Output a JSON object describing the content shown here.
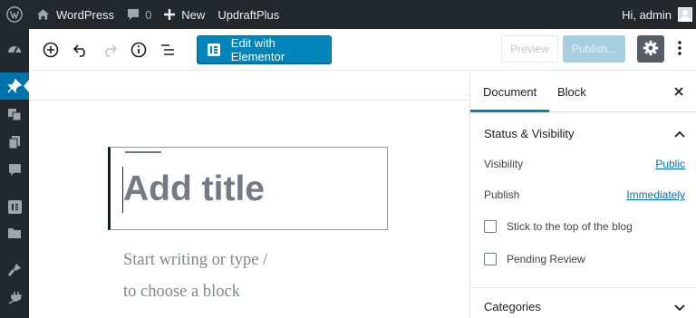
{
  "adminbar": {
    "site_name": "WordPress",
    "comments_count": "0",
    "new_label": "New",
    "plugin_label": "UpdraftPlus",
    "greeting": "Hi, admin"
  },
  "toolbar": {
    "edit_elementor_label": "Edit with Elementor",
    "preview_label": "Preview",
    "publish_label": "Publish..."
  },
  "editor": {
    "title_placeholder": "Add title",
    "paragraph_placeholder_line1": "Start writing or type /",
    "paragraph_placeholder_line2": "to choose a block"
  },
  "sidebar": {
    "tabs": [
      {
        "label": "Document",
        "active": true
      },
      {
        "label": "Block",
        "active": false
      }
    ],
    "status_visibility": {
      "title": "Status & Visibility",
      "visibility_label": "Visibility",
      "visibility_value": "Public",
      "publish_label": "Publish",
      "publish_value": "Immediately",
      "sticky_label": "Stick to the top of the blog",
      "sticky_checked": false,
      "pending_label": "Pending Review",
      "pending_checked": false
    },
    "categories_title": "Categories"
  },
  "colors": {
    "admin_dark": "#23282d",
    "accent_blue": "#0085ba",
    "link_blue": "#0073aa"
  },
  "icons": [
    "wordpress-logo-icon",
    "home-icon",
    "comment-icon",
    "plus-icon",
    "dashboard-icon",
    "pin-icon",
    "media-icon",
    "pages-icon",
    "comments-icon",
    "elementor-icon",
    "folder-icon",
    "appearance-icon",
    "plugins-icon",
    "add-block-icon",
    "undo-icon",
    "redo-icon",
    "info-icon",
    "outline-icon",
    "gear-icon",
    "more-vertical-icon",
    "close-icon",
    "chevron-up-icon",
    "chevron-down-icon"
  ]
}
